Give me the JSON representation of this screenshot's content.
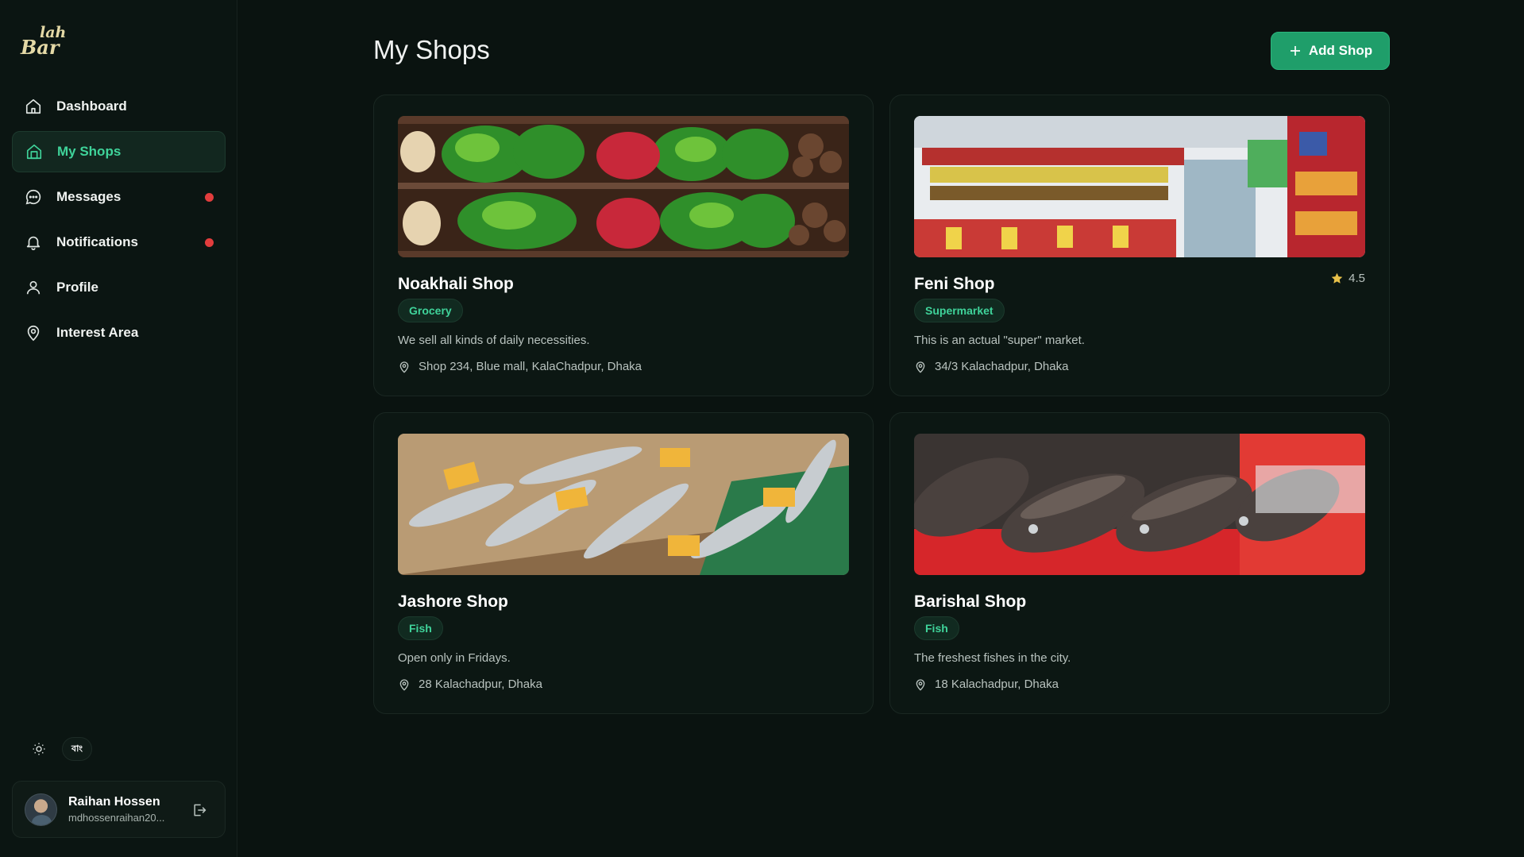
{
  "brand": {
    "logo_line1": "lah",
    "logo_line2": "Bar"
  },
  "nav": {
    "items": [
      {
        "label": "Dashboard",
        "icon": "home-icon",
        "active": false,
        "badge": false
      },
      {
        "label": "My Shops",
        "icon": "shop-icon",
        "active": true,
        "badge": false
      },
      {
        "label": "Messages",
        "icon": "chat-icon",
        "active": false,
        "badge": true
      },
      {
        "label": "Notifications",
        "icon": "bell-icon",
        "active": false,
        "badge": true
      },
      {
        "label": "Profile",
        "icon": "user-icon",
        "active": false,
        "badge": false
      },
      {
        "label": "Interest Area",
        "icon": "map-pin-icon",
        "active": false,
        "badge": false
      }
    ]
  },
  "utility": {
    "language_label": "বাং",
    "theme_icon": "sun-icon"
  },
  "user": {
    "name": "Raihan Hossen",
    "email": "mdhossenraihan20...",
    "logout_icon": "logout-icon"
  },
  "page": {
    "title": "My Shops",
    "add_button_label": "Add Shop"
  },
  "colors": {
    "accent": "#3fd39a",
    "button": "#1f9e6a",
    "notification_dot": "#e23d3d",
    "background": "#0a1310"
  },
  "shops": [
    {
      "name": "Noakhali Shop",
      "category": "Grocery",
      "description": "We sell all kinds of daily necessities.",
      "address": "Shop 234, Blue mall, KalaChadpur, Dhaka",
      "rating": null,
      "image": "vegetables-display"
    },
    {
      "name": "Feni Shop",
      "category": "Supermarket",
      "description": "This is an actual \"super\" market.",
      "address": "34/3 Kalachadpur, Dhaka",
      "rating": "4.5",
      "image": "supermarket-aisle"
    },
    {
      "name": "Jashore Shop",
      "category": "Fish",
      "description": "Open only in Fridays.",
      "address": "28 Kalachadpur, Dhaka",
      "rating": null,
      "image": "fish-market-stall"
    },
    {
      "name": "Barishal Shop",
      "category": "Fish",
      "description": "The freshest fishes in the city.",
      "address": "18 Kalachadpur, Dhaka",
      "rating": null,
      "image": "fish-on-ice"
    }
  ]
}
